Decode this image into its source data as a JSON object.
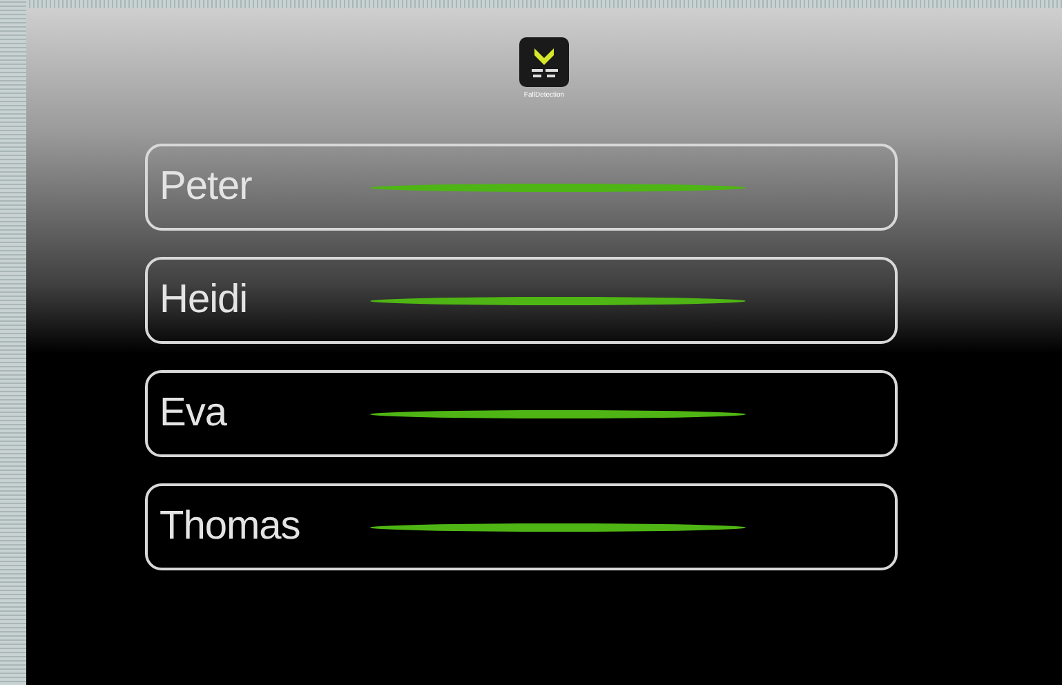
{
  "app": {
    "label": "FallDetection"
  },
  "people": [
    {
      "name": "Peter"
    },
    {
      "name": "Heidi"
    },
    {
      "name": "Eva"
    },
    {
      "name": "Thomas"
    }
  ]
}
